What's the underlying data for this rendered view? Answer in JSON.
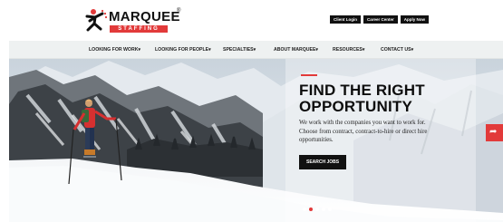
{
  "brand": {
    "name": "MARQUEE",
    "registered": "®",
    "tagline": "STAFFING"
  },
  "top_buttons": [
    {
      "label": "Client Login"
    },
    {
      "label": "Career Center"
    },
    {
      "label": "Apply Now"
    }
  ],
  "nav": [
    {
      "label": "LOOKING FOR WORK▾"
    },
    {
      "label": "LOOKING FOR PEOPLE▾"
    },
    {
      "label": "SPECIALTIES▾"
    },
    {
      "label": "ABOUT MARQUEE▾"
    },
    {
      "label": "RESOURCES▾"
    },
    {
      "label": "CONTACT US▾"
    }
  ],
  "hero": {
    "title_line1": "FIND THE RIGHT",
    "title_line2": "OPPORTUNITY",
    "text": "We work with the companies you want to work for. Choose from contract, contract-to-hire or direct hire opportunities.",
    "cta": "SEARCH JOBS",
    "slides": 5,
    "active_slide": 2
  },
  "colors": {
    "accent": "#e23a3a",
    "dark": "#111111",
    "nav_bg": "#eef1f1"
  },
  "icons": {
    "side_tab": "share-arrow-icon"
  }
}
